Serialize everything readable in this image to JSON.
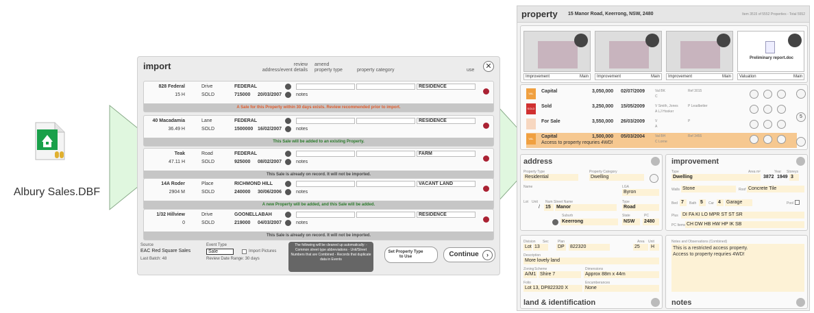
{
  "file": {
    "label": "Albury Sales.DBF",
    "icon": "database-file-icon"
  },
  "import": {
    "title": "import",
    "headers": {
      "review": "review",
      "address": "address/event details",
      "amend": "amend",
      "ptype": "property type",
      "pcat": "property category",
      "use": "use"
    },
    "records": [
      {
        "num": "828 Federal",
        "stype": "Drive",
        "suburb": "FEDERAL",
        "area": "15 H",
        "status": "SOLD",
        "price": "715000",
        "date": "20/03/2007",
        "notes": "notes",
        "category": "RESIDENCE",
        "message": "A Sale for this Property within 30 days exists. Review recommended prior to import.",
        "msgcolor": "#e05a2a"
      },
      {
        "num": "40 Macadamia",
        "stype": "Lane",
        "suburb": "FEDERAL",
        "area": "36.49 H",
        "status": "SOLD",
        "price": "1500000",
        "date": "16/02/2007",
        "notes": "notes",
        "category": "RESIDENCE",
        "message": "This Sale will be added to an existing Property.",
        "msgcolor": "#2a7a2a"
      },
      {
        "num": "Teak",
        "stype": "Road",
        "suburb": "FEDERAL",
        "area": "47.11 H",
        "status": "SOLD",
        "price": "925000",
        "date": "08/02/2007",
        "notes": "notes",
        "category": "FARM",
        "message": "This Sale is already on record. It will not be imported.",
        "msgcolor": "#444444"
      },
      {
        "num": "14A Roder",
        "stype": "Place",
        "suburb": "RICHMOND HILL",
        "area": "2904 M",
        "status": "SOLD",
        "price": "240000",
        "date": "30/06/2006",
        "notes": "notes",
        "category": "VACANT LAND",
        "message": "A new Property will be added, and this Sale will be added.",
        "msgcolor": "#2a7a2a"
      },
      {
        "num": "1/32 Hillview",
        "stype": "Drive",
        "suburb": "GOONELLABAH",
        "area": "0",
        "status": "SOLD",
        "price": "219000",
        "date": "04/03/2007",
        "notes": "notes",
        "category": "RESIDENCE",
        "message": "This Sale is already on record. It will not be imported.",
        "msgcolor": "#444444"
      }
    ],
    "source_label": "Source",
    "source": "EAC Red Square Sales",
    "last_batch": "Last Batch: 48",
    "event_type_label": "Event Type",
    "event_type": "Sale",
    "import_pictures": "Import Pictures",
    "review_range": "Review Date Range: 30 days",
    "cleanup_note": "The following will be cleaned up automatically: - Common street type abbreviations - Unit/Street Numbers that are Combined - Records that duplicate data in Events",
    "set_prop_btn": "Set Property Type to Use",
    "continue_btn": "Continue"
  },
  "property": {
    "title": "property",
    "address": "15 Manor Road, Keerrong, NSW, 2480",
    "item_info": "Item 3515 of 5552 Properties - Total 5552",
    "thumbs": [
      {
        "label": "Improvement",
        "main": "Main"
      },
      {
        "label": "Improvement",
        "main": "Main"
      },
      {
        "label": "Improvement",
        "main": "Main"
      },
      {
        "label": "Valuation",
        "main": "Main",
        "doc": "Preliminary report.doc"
      }
    ],
    "sales": [
      {
        "tag": "VAL",
        "type": "Capital",
        "price": "3,050,000",
        "date": "02/07/2009",
        "party": "Val BK",
        "party2": "C",
        "ref": "Ref 3015"
      },
      {
        "tag": "SOLD",
        "type": "Sold",
        "price": "3,250,000",
        "date": "15/05/2009",
        "party": "V Smith, Jones",
        "party2": "A LJ Hooker",
        "ref": "P Leadbetter"
      },
      {
        "tag": "",
        "type": "For Sale",
        "price": "3,550,000",
        "date": "26/03/2009",
        "party": "V",
        "party2": "A",
        "ref": "P"
      },
      {
        "tag": "VAL",
        "type": "Capital",
        "price": "1,500,000",
        "date": "05/03/2004",
        "party": "Val BH",
        "party2": "C Lorne",
        "ref": "Ref 3455",
        "note": "Access to property requries 4WD!"
      }
    ],
    "side_count": "5",
    "address_sec": {
      "title": "address",
      "ptype_l": "Property Type",
      "ptype": "Residential",
      "pcat_l": "Property Category",
      "pcat": "Dwelling",
      "name_l": "Name",
      "lga_l": "LGA",
      "lga": "Byron",
      "lot_l": "Lot",
      "unit_l": "Unit",
      "num_l": "Num",
      "street_l": "Street Name",
      "type_l": "Type",
      "num": "15",
      "street": "Manor",
      "stype": "Road",
      "slash": "/",
      "suburb_l": "Suburb",
      "state_l": "State",
      "pc_l": "PC",
      "suburb": "Keerrong",
      "state": "NSW",
      "pc": "2480"
    },
    "improvement": {
      "title": "improvement",
      "type_l": "Type",
      "area_l": "Area m²",
      "year_l": "Year",
      "storeys_l": "Storeys",
      "type": "Dwelling",
      "area": "3872",
      "year": "1949",
      "storeys": "3",
      "walls_l": "Walls",
      "walls": "Stone",
      "roof_l": "Roof",
      "roof": "Concrete Tile",
      "bed_l": "Bed",
      "bed": "7",
      "bath_l": "Bath",
      "bath": "5",
      "car_l": "Car",
      "car": "4",
      "garage": "Garage",
      "pool_l": "Pool",
      "plus_l": "Plus",
      "plus": "DI FA KI LO MPR ST ST SR",
      "pc_items_l": "PC Items",
      "pc_items": "CH DW HB HW HP IK SB"
    },
    "land": {
      "title": "land & identification",
      "div_l": "Division",
      "sec_l": "Sec",
      "plan_l": "Plan",
      "area_l": "Area",
      "unit_l": "Unit",
      "lot": "Lot",
      "lot_num": "13",
      "plan_t": "DP",
      "plan": "822320",
      "area": "25",
      "unit": "H",
      "desc_l": "Description",
      "desc": "More lovely land",
      "zoning_l": "Zoning",
      "scheme_l": "Scheme",
      "dims_l": "Dimensions",
      "zoning": "A/M1",
      "scheme": "Shire 7",
      "dims": "Approx 88m x 44m",
      "folio_l": "Folio",
      "enc_l": "Encumberances",
      "folio": "Lot 13, DP822320 X",
      "enc": "None"
    },
    "notes": {
      "title": "notes",
      "label": "Notes and Observations (Combined)",
      "text1": "This is a restricted access property.",
      "text2": "Access to property requries 4WD!"
    }
  }
}
